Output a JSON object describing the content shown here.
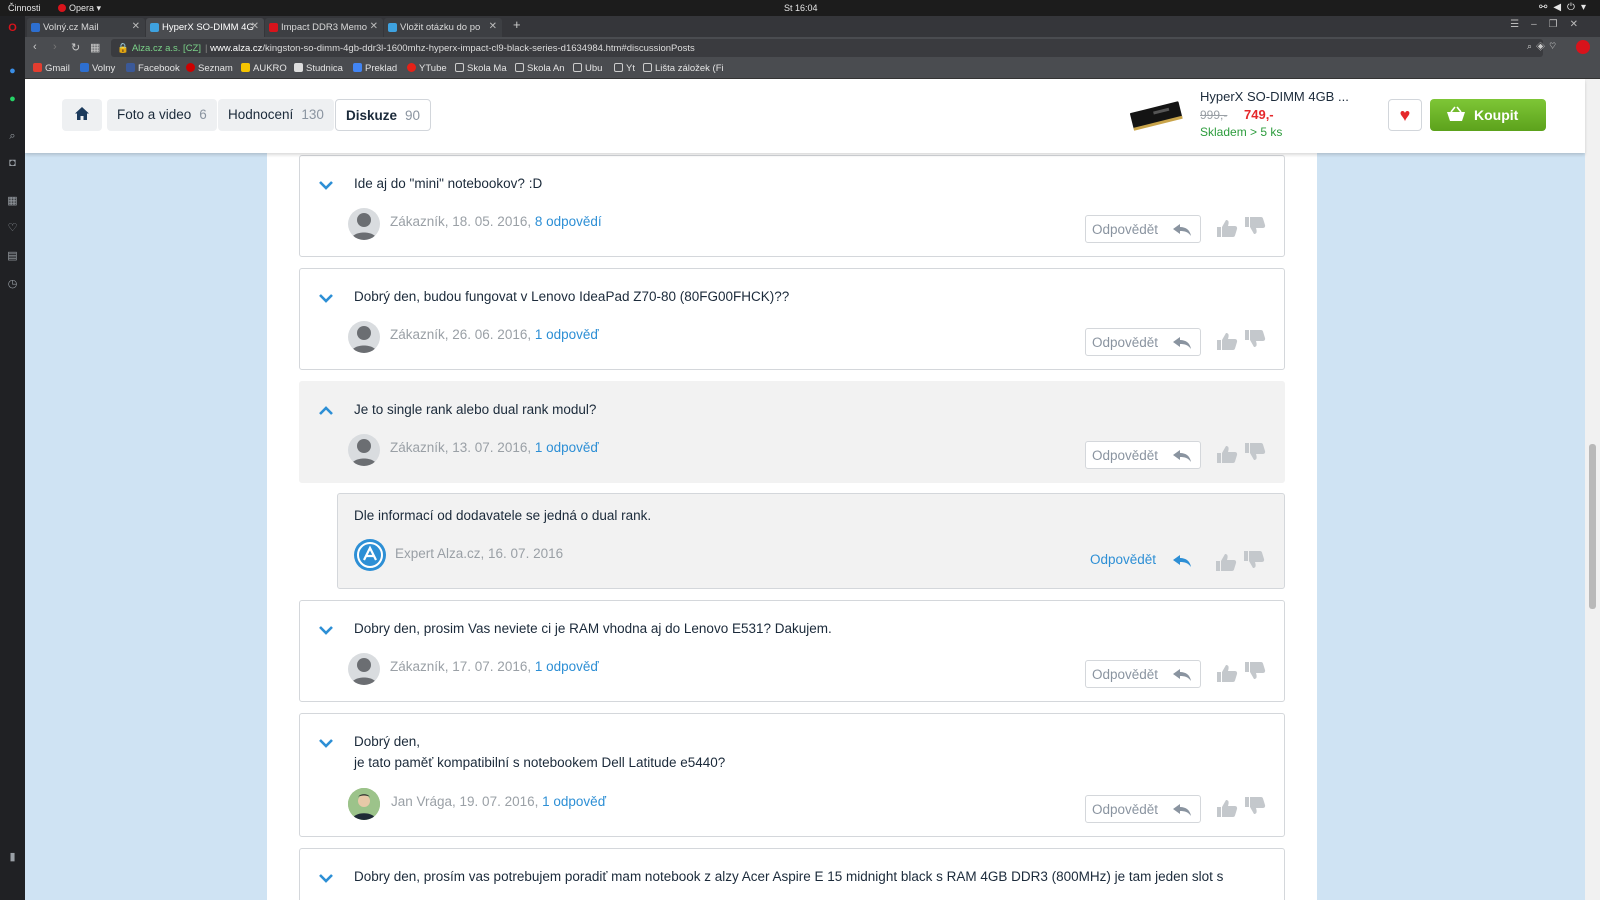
{
  "system": {
    "activities": "Činnosti",
    "app_menu": "Opera ▾",
    "clock": "St 16:04"
  },
  "browser": {
    "tabs": [
      {
        "label": "Volný.cz Mail",
        "active": false,
        "color": "#2d6fd0"
      },
      {
        "label": "HyperX SO-DIMM 4G",
        "active": true,
        "color": "#3ea2e0"
      },
      {
        "label": "Impact DDR3 Memo",
        "active": false,
        "color": "#d8131b"
      },
      {
        "label": "Vložit otázku do po",
        "active": false,
        "color": "#3ea2e0"
      }
    ],
    "new_tab": "+",
    "address": {
      "secure_label": "Alza.cz a.s. [CZ]",
      "url_domain": "www.alza.cz",
      "url_path": "/kingston-so-dimm-4gb-ddr3l-1600mhz-hyperx-impact-cl9-black-series-d1634984.htm#discussionPosts"
    },
    "bookmarks": [
      {
        "label": "Gmail",
        "color": "#e23d2f"
      },
      {
        "label": "Volny",
        "color": "#2d6fd0"
      },
      {
        "label": "Facebook",
        "color": "#3b5998"
      },
      {
        "label": "Seznam",
        "color": "#cc0000"
      },
      {
        "label": "AUKRO",
        "color": "#f5c400"
      },
      {
        "label": "Studnica",
        "color": "#dddddd"
      },
      {
        "label": "Preklad",
        "color": "#4285f4"
      },
      {
        "label": "YTube",
        "color": "#e62117"
      },
      {
        "label": "Skola Ma",
        "color": "folder"
      },
      {
        "label": "Skola An",
        "color": "folder"
      },
      {
        "label": "Ubu",
        "color": "folder"
      },
      {
        "label": "Yt",
        "color": "folder"
      },
      {
        "label": "Lišta záložek (Fi",
        "color": "folder"
      }
    ]
  },
  "nav": {
    "tabs": [
      {
        "label": "Foto a video",
        "count": "6"
      },
      {
        "label": "Hodnocení",
        "count": "130"
      },
      {
        "label": "Diskuze",
        "count": "90"
      }
    ]
  },
  "product": {
    "name": "HyperX SO-DIMM 4GB ...",
    "old_price": "999,-",
    "price": "749,-",
    "stock": "Skladem > 5 ks",
    "buy_label": "Koupit"
  },
  "questions": [
    {
      "text": "Ide aj do \"mini\" notebookov? :D",
      "author": "Zákazník, 18. 05. 2016,",
      "answers": "8 odpovědí",
      "reply": "Odpovědět",
      "expanded": false
    },
    {
      "text": "Dobrý den, budou fungovat v Lenovo IdeaPad Z70-80 (80FG00FHCK)??",
      "author": "Zákazník, 26. 06. 2016,",
      "answers": "1 odpověď",
      "reply": "Odpovědět",
      "expanded": false
    },
    {
      "text": "Je to single rank alebo dual rank modul?",
      "author": "Zákazník, 13. 07. 2016,",
      "answers": "1 odpověď",
      "reply": "Odpovědět",
      "expanded": true
    },
    {
      "text": "Dobry den, prosim Vas neviete ci je RAM vhodna aj do Lenovo E531? Dakujem.",
      "author": "Zákazník, 17. 07. 2016,",
      "answers": "1 odpověď",
      "reply": "Odpovědět",
      "expanded": false
    },
    {
      "text_line1": "Dobrý den,",
      "text_line2": "je tato paměť kompatibilní s notebookem Dell Latitude e5440?",
      "author": "Jan Vrága, 19. 07. 2016,",
      "answers": "1 odpověď",
      "reply": "Odpovědět",
      "expanded": false
    },
    {
      "text": "Dobry den, prosím vas potrebujem poradiť mam notebook z alzy Acer Aspire E 15 midnight black s RAM 4GB DDR3 (800MHz) je tam jeden slot s",
      "expanded": false
    }
  ],
  "answer": {
    "text": "Dle informací od dodavatele se jedná o dual rank.",
    "author": "Expert Alza.cz, 16. 07. 2016",
    "reply": "Odpovědět"
  }
}
